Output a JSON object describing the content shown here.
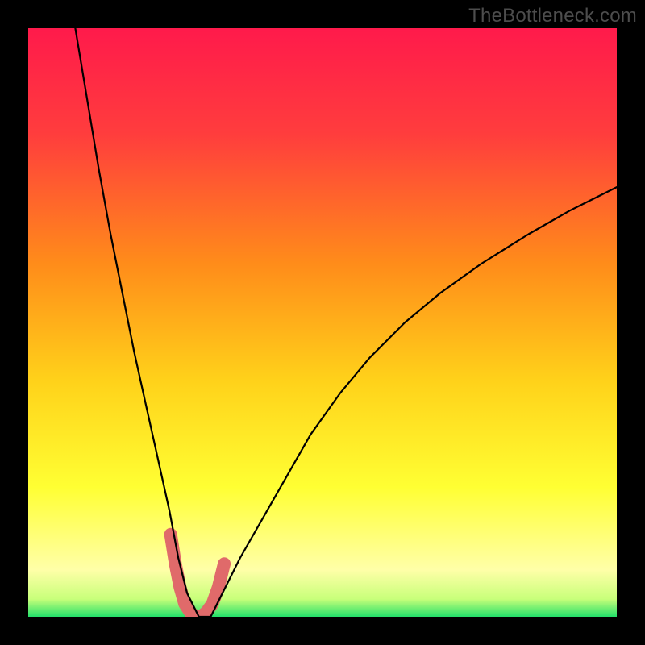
{
  "attribution": "TheBottleneck.com",
  "chart_data": {
    "type": "line",
    "title": "",
    "xlabel": "",
    "ylabel": "",
    "xlim": [
      0,
      100
    ],
    "ylim": [
      0,
      100
    ],
    "gradient_stops": [
      {
        "offset": 0,
        "color": "#ff1a4b"
      },
      {
        "offset": 0.18,
        "color": "#ff3d3d"
      },
      {
        "offset": 0.4,
        "color": "#ff8c1a"
      },
      {
        "offset": 0.6,
        "color": "#ffd21a"
      },
      {
        "offset": 0.78,
        "color": "#ffff33"
      },
      {
        "offset": 0.92,
        "color": "#ffffa8"
      },
      {
        "offset": 0.97,
        "color": "#c8ff7a"
      },
      {
        "offset": 1.0,
        "color": "#22e06a"
      }
    ],
    "series": [
      {
        "name": "bottleneck-curve",
        "x": [
          8,
          10,
          12,
          14,
          16,
          18,
          20,
          22,
          24,
          25.5,
          27,
          29,
          31,
          33,
          36,
          40,
          44,
          48,
          53,
          58,
          64,
          70,
          77,
          85,
          92,
          100
        ],
        "y": [
          100,
          88,
          76,
          65,
          55,
          45,
          36,
          27,
          18,
          10,
          4,
          0,
          0,
          4,
          10,
          17,
          24,
          31,
          38,
          44,
          50,
          55,
          60,
          65,
          69,
          73
        ],
        "color": "#000000",
        "stroke_width": 2.2
      },
      {
        "name": "valley-highlight",
        "x": [
          24.2,
          25.0,
          25.8,
          26.6,
          27.5,
          28.4,
          29.3,
          30.3,
          31.3,
          32.3,
          33.3
        ],
        "y": [
          14,
          9,
          5,
          2.2,
          0.8,
          0,
          0,
          0.8,
          2.2,
          5,
          9
        ],
        "color": "#e06a6a",
        "stroke_width": 16
      }
    ]
  }
}
